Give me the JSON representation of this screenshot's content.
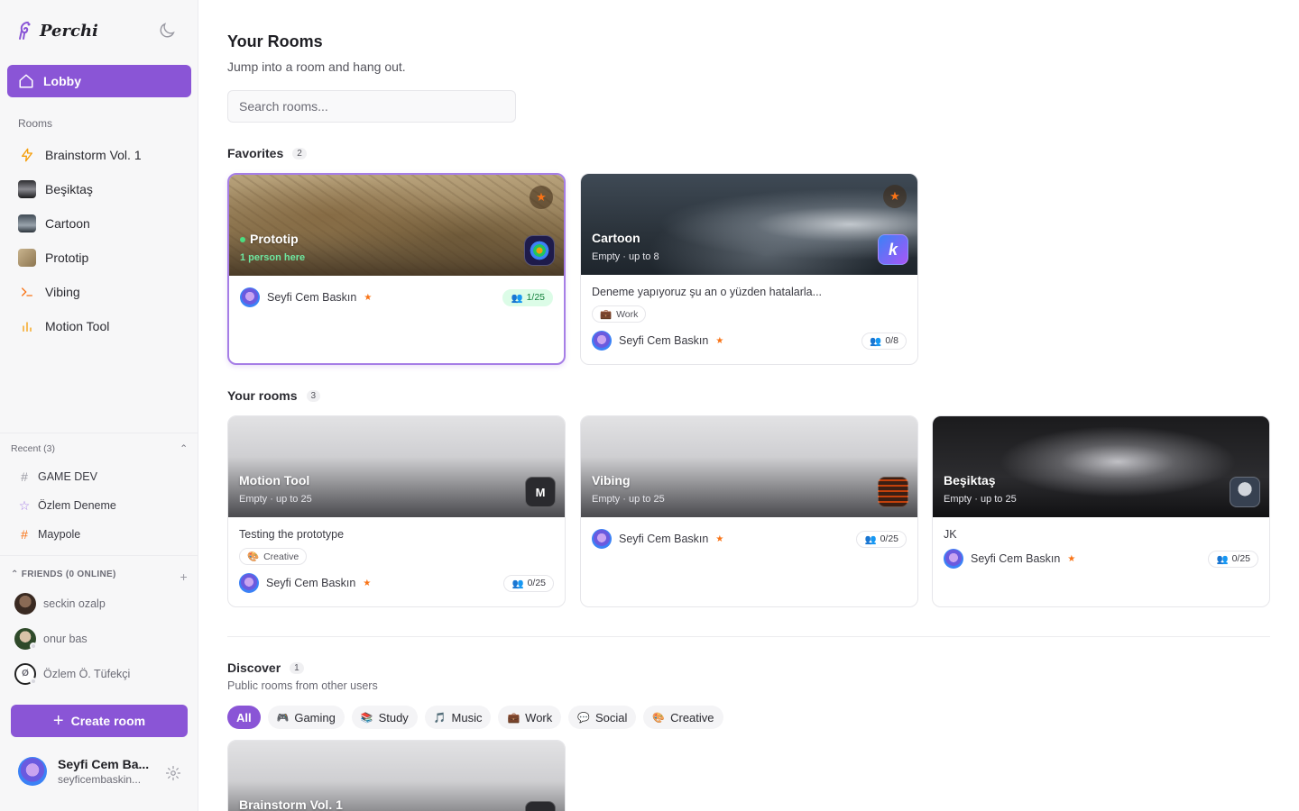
{
  "app": {
    "name": "Perchi"
  },
  "sidebar": {
    "lobby_label": "Lobby",
    "rooms_label": "Rooms",
    "rooms": [
      {
        "label": "Brainstorm Vol. 1",
        "icon": "lightning-icon"
      },
      {
        "label": "Beşiktaş",
        "icon": "room-thumbnail"
      },
      {
        "label": "Cartoon",
        "icon": "room-thumbnail"
      },
      {
        "label": "Prototip",
        "icon": "room-thumbnail"
      },
      {
        "label": "Vibing",
        "icon": "terminal-icon"
      },
      {
        "label": "Motion Tool",
        "icon": "bar-chart-icon"
      }
    ],
    "recent_label": "Recent (3)",
    "recent": [
      {
        "label": "GAME DEV",
        "icon": "hash-icon"
      },
      {
        "label": "Özlem Deneme",
        "icon": "star-outline-icon"
      },
      {
        "label": "Maypole",
        "icon": "hash-icon"
      }
    ],
    "friends_label": "FRIENDS (0 ONLINE)",
    "friends": [
      {
        "name": "seckin ozalp"
      },
      {
        "name": "onur bas"
      },
      {
        "name": "Özlem Ö. Tüfekçi"
      }
    ],
    "create_label": "Create room",
    "profile": {
      "name": "Seyfi Cem Ba...",
      "email": "seyficembaskin..."
    }
  },
  "main": {
    "title": "Your Rooms",
    "subtitle": "Jump into a room and hang out.",
    "search_placeholder": "Search rooms...",
    "favorites": {
      "label": "Favorites",
      "count": "2",
      "cards": [
        {
          "name": "Prototip",
          "status": "1 person here",
          "owner": "Seyfi Cem Baskın",
          "count": "1/25"
        },
        {
          "name": "Cartoon",
          "status": "Empty · up to 8",
          "description": "Deneme yapıyoruz şu an o yüzden hatalarla...",
          "tag": "Work",
          "owner": "Seyfi Cem Baskın",
          "count": "0/8",
          "icon_letter": "k"
        }
      ]
    },
    "your_rooms": {
      "label": "Your rooms",
      "count": "3",
      "cards": [
        {
          "name": "Motion Tool",
          "status": "Empty · up to 25",
          "description": "Testing the prototype",
          "tag": "Creative",
          "owner": "Seyfi Cem Baskın",
          "count": "0/25",
          "icon_letter": "M"
        },
        {
          "name": "Vibing",
          "status": "Empty · up to 25",
          "owner": "Seyfi Cem Baskın",
          "count": "0/25"
        },
        {
          "name": "Beşiktaş",
          "status": "Empty · up to 25",
          "description": "JK",
          "owner": "Seyfi Cem Baskın",
          "count": "0/25"
        }
      ]
    },
    "discover": {
      "label": "Discover",
      "count": "1",
      "subtitle": "Public rooms from other users",
      "filters": [
        {
          "label": "All",
          "active": true
        },
        {
          "label": "Gaming",
          "icon": "gamepad-icon"
        },
        {
          "label": "Study",
          "icon": "books-icon"
        },
        {
          "label": "Music",
          "icon": "music-note-icon"
        },
        {
          "label": "Work",
          "icon": "briefcase-icon"
        },
        {
          "label": "Social",
          "icon": "chat-bubble-icon"
        },
        {
          "label": "Creative",
          "icon": "palette-icon"
        }
      ],
      "cards": [
        {
          "name": "Brainstorm Vol. 1"
        }
      ]
    }
  },
  "colors": {
    "accent": "#8a55d6",
    "favorite_star": "#f97316",
    "online_green": "#4ade80"
  }
}
